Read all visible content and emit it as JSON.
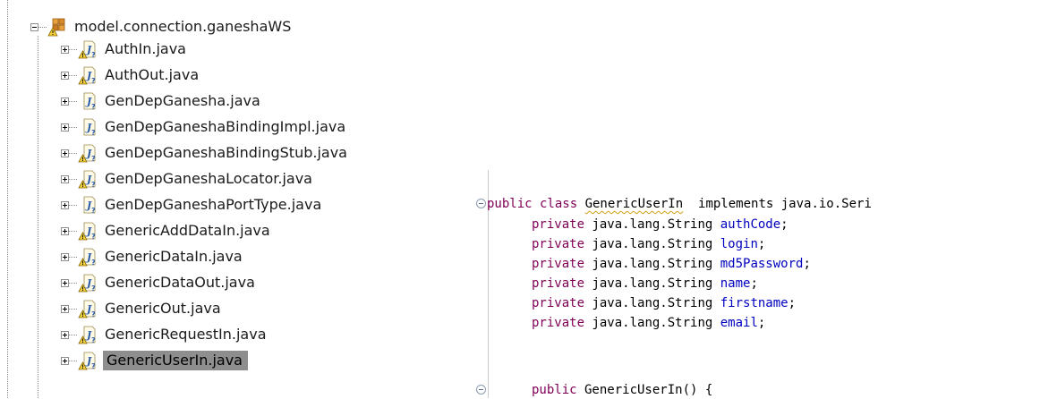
{
  "package_explorer": {
    "package_name": "model.connection.ganeshaWS",
    "files": [
      {
        "name": "AuthIn.java",
        "warning": true,
        "selected": false
      },
      {
        "name": "AuthOut.java",
        "warning": true,
        "selected": false
      },
      {
        "name": "GenDepGanesha.java",
        "warning": false,
        "selected": false
      },
      {
        "name": "GenDepGaneshaBindingImpl.java",
        "warning": false,
        "selected": false
      },
      {
        "name": "GenDepGaneshaBindingStub.java",
        "warning": true,
        "selected": false
      },
      {
        "name": "GenDepGaneshaLocator.java",
        "warning": true,
        "selected": false
      },
      {
        "name": "GenDepGaneshaPortType.java",
        "warning": false,
        "selected": false
      },
      {
        "name": "GenericAddDataIn.java",
        "warning": true,
        "selected": false
      },
      {
        "name": "GenericDataIn.java",
        "warning": true,
        "selected": false
      },
      {
        "name": "GenericDataOut.java",
        "warning": true,
        "selected": false
      },
      {
        "name": "GenericOut.java",
        "warning": true,
        "selected": false
      },
      {
        "name": "GenericRequestIn.java",
        "warning": true,
        "selected": false
      },
      {
        "name": "GenericUserIn.java",
        "warning": true,
        "selected": true
      }
    ]
  },
  "editor": {
    "class_line": {
      "prefix": "public class ",
      "class_name": "GenericUserIn",
      "suffix": "  implements java.io.Seri"
    },
    "field_prefix": "private java.lang.String ",
    "fields": [
      "authCode",
      "login",
      "md5Password",
      "name",
      "firstname",
      "email"
    ],
    "constructor_line": "public GenericUserIn() {"
  },
  "colors": {
    "keyword": "#7f0055",
    "field": "#0000c0",
    "selection": "#8e8e8e",
    "warning": "#d4a017"
  }
}
